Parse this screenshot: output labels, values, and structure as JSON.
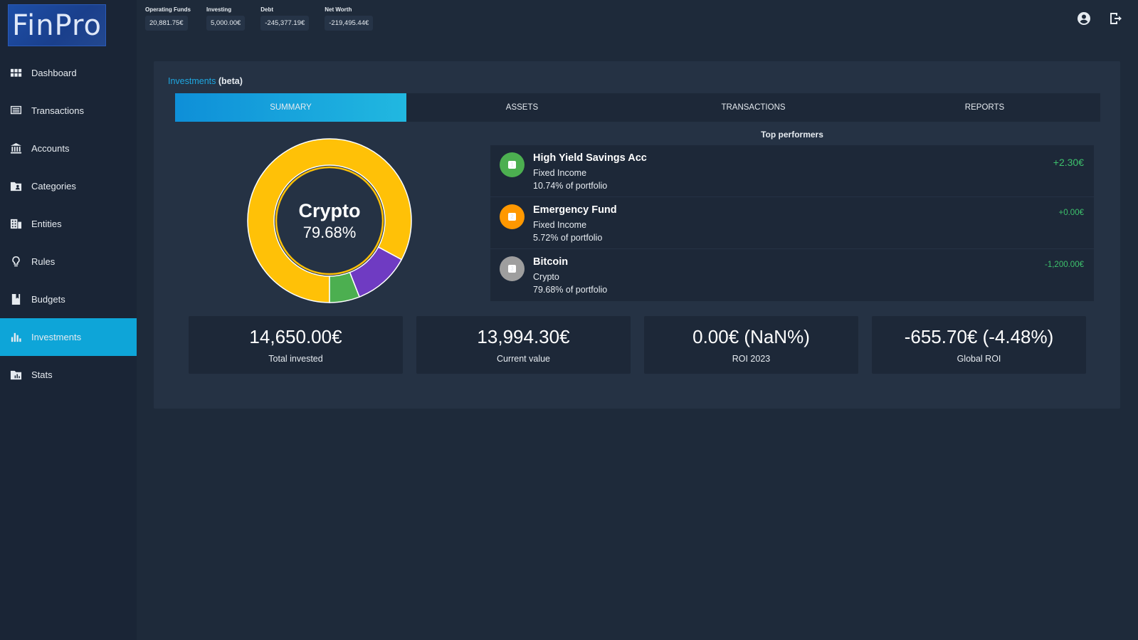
{
  "app": {
    "logo": "FinPro"
  },
  "sidebar": {
    "items": [
      {
        "label": "Dashboard",
        "icon": "grid-icon"
      },
      {
        "label": "Transactions",
        "icon": "list-icon"
      },
      {
        "label": "Accounts",
        "icon": "bank-icon"
      },
      {
        "label": "Categories",
        "icon": "folder-user-icon"
      },
      {
        "label": "Entities",
        "icon": "building-icon"
      },
      {
        "label": "Rules",
        "icon": "lightbulb-icon"
      },
      {
        "label": "Budgets",
        "icon": "book-icon"
      },
      {
        "label": "Investments",
        "icon": "bar-chart-icon",
        "active": true
      },
      {
        "label": "Stats",
        "icon": "folder-chart-icon"
      }
    ]
  },
  "topbar": {
    "stats": [
      {
        "label": "Operating Funds",
        "value": "20,881.75€"
      },
      {
        "label": "Investing",
        "value": "5,000.00€"
      },
      {
        "label": "Debt",
        "value": "-245,377.19€"
      },
      {
        "label": "Net Worth",
        "value": "-219,495.44€"
      }
    ],
    "icons": [
      "account-circle-icon",
      "logout-icon"
    ]
  },
  "page": {
    "breadcrumb_link": "Investments",
    "breadcrumb_suffix": "(beta)",
    "tabs": [
      {
        "label": "SUMMARY",
        "active": true
      },
      {
        "label": "ASSETS"
      },
      {
        "label": "TRANSACTIONS"
      },
      {
        "label": "REPORTS"
      }
    ]
  },
  "donut": {
    "center_label": "Crypto",
    "center_value": "79.68%",
    "slices": [
      {
        "name": "Crypto",
        "percent": 79.68,
        "color": "#ffc107"
      },
      {
        "name": "High Yield Savings Acc",
        "percent": 10.74,
        "color": "#6f3bc2"
      },
      {
        "name": "Emergency Fund",
        "percent": 5.72,
        "color": "#4caf50"
      }
    ],
    "highlight_color": "#ffc107"
  },
  "top_performers": {
    "title": "Top performers",
    "items": [
      {
        "rank": "1",
        "name": "High Yield Savings Acc",
        "type": "Fixed Income",
        "portfolio": "10.74% of portfolio",
        "delta": "+2.30€",
        "badge_color": "#4caf50",
        "delta_size": "14px"
      },
      {
        "rank": "2",
        "name": "Emergency Fund",
        "type": "Fixed Income",
        "portfolio": "5.72% of portfolio",
        "delta": "+0.00€",
        "badge_color": "#ff9800",
        "delta_size": "11.5px"
      },
      {
        "rank": "3",
        "name": "Bitcoin",
        "type": "Crypto",
        "portfolio": "79.68% of portfolio",
        "delta": "-1,200.00€",
        "badge_color": "#9e9e9e",
        "delta_size": "11.5px"
      }
    ]
  },
  "summary_cards": [
    {
      "value": "14,650.00€",
      "label": "Total invested"
    },
    {
      "value": "13,994.30€",
      "label": "Current value"
    },
    {
      "value": "0.00€ (NaN%)",
      "label": "ROI 2023"
    },
    {
      "value": "-655.70€ (-4.48%)",
      "label": "Global ROI"
    }
  ]
}
